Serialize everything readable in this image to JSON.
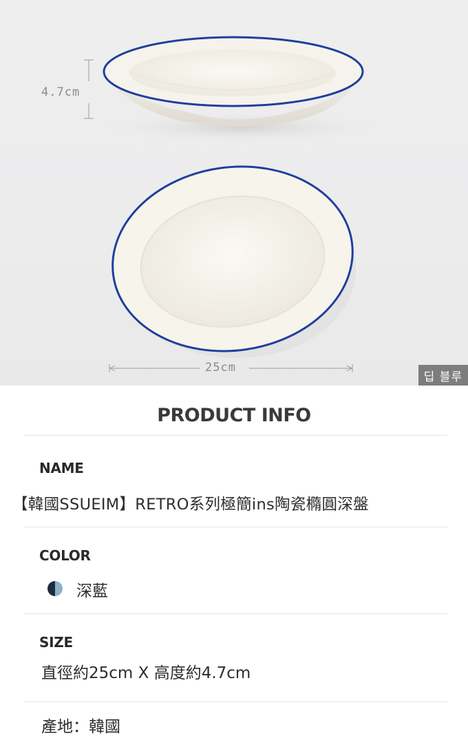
{
  "photo": {
    "height_label": "4.7cm",
    "width_label": "25cm",
    "color_tag": "딥 블루",
    "rim_color": "#1f3f9c",
    "plate_color": "#f7f4ec"
  },
  "info": {
    "title": "PRODUCT INFO",
    "name": {
      "label": "NAME",
      "value": "【韓國SSUEIM】RETRO系列極簡ins陶瓷橢圓深盤"
    },
    "color": {
      "label": "COLOR",
      "value": "深藍",
      "swatch_dark": "#1d2b3f",
      "swatch_light": "#8db0c9"
    },
    "size": {
      "label": "SIZE",
      "value": "直徑約25cm X 高度約4.7cm"
    },
    "origin": "產地：韓國"
  }
}
